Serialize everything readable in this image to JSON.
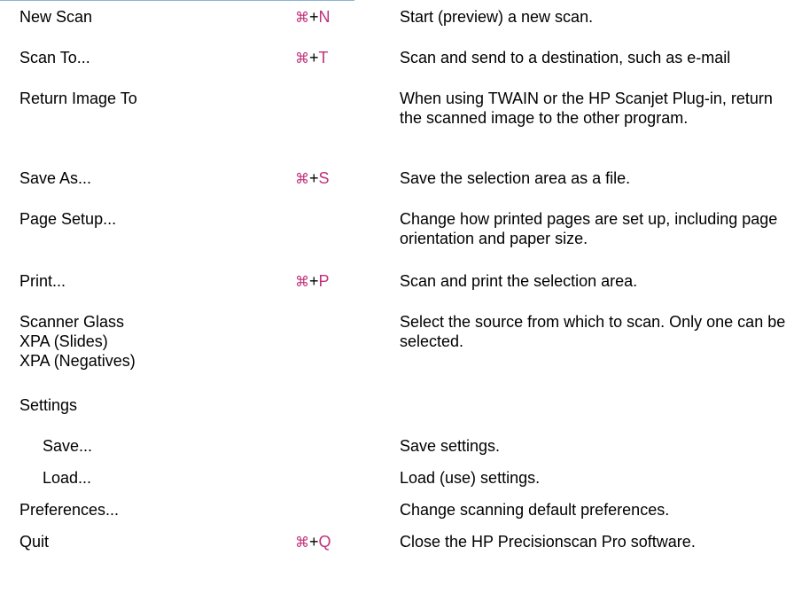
{
  "colors": {
    "accent": "#c0307a",
    "rule": "#8ab4d8"
  },
  "rows": [
    {
      "command": [
        "New Scan"
      ],
      "indent": false,
      "shortcut": {
        "icon": "command-key-icon",
        "symbol": "⌘",
        "sep": "+",
        "key": "N"
      },
      "description": "Start (preview) a new scan."
    },
    {
      "command": [
        "Scan To..."
      ],
      "indent": false,
      "shortcut": {
        "icon": "command-key-icon",
        "symbol": "⌘",
        "sep": "+",
        "key": "T"
      },
      "description": "Scan and send to a destination, such as e-mail"
    },
    {
      "command": [
        "Return Image To"
      ],
      "indent": false,
      "shortcut": null,
      "description": "When using TWAIN or the HP Scanjet Plug-in, return the scanned image to the other program."
    },
    {
      "command": [
        "Save As..."
      ],
      "indent": false,
      "shortcut": {
        "icon": "command-key-icon",
        "symbol": "⌘",
        "sep": "+",
        "key": "S"
      },
      "description": "Save the selection area as a file."
    },
    {
      "command": [
        "Page Setup..."
      ],
      "indent": false,
      "shortcut": null,
      "description": "Change how printed pages are set up, including page orientation and paper size."
    },
    {
      "command": [
        "Print..."
      ],
      "indent": false,
      "shortcut": {
        "icon": "command-key-icon",
        "symbol": "⌘",
        "sep": "+",
        "key": "P"
      },
      "description": "Scan and print the selection area."
    },
    {
      "command": [
        "Scanner Glass",
        "XPA (Slides)",
        "XPA (Negatives)"
      ],
      "indent": false,
      "shortcut": null,
      "description": "Select the source from which to scan. Only one can be selected."
    },
    {
      "command": [
        "Settings"
      ],
      "indent": false,
      "shortcut": null,
      "description": ""
    },
    {
      "command": [
        "Save..."
      ],
      "indent": true,
      "shortcut": null,
      "description": "Save settings."
    },
    {
      "command": [
        "Load..."
      ],
      "indent": true,
      "shortcut": null,
      "description": "Load (use) settings."
    },
    {
      "command": [
        "Preferences..."
      ],
      "indent": false,
      "shortcut": null,
      "description": "Change scanning default preferences."
    },
    {
      "command": [
        "Quit"
      ],
      "indent": false,
      "shortcut": {
        "icon": "command-key-icon",
        "symbol": "⌘",
        "sep": "+",
        "key": "Q"
      },
      "description": "Close the HP Precisionscan Pro software."
    }
  ]
}
